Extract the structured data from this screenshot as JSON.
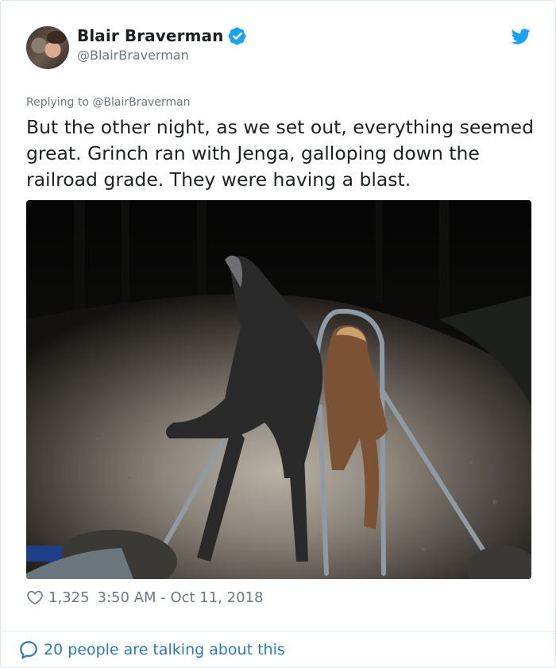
{
  "author": {
    "name": "Blair Braverman",
    "handle": "@BlairBraverman",
    "verified": true,
    "avatar_icon": "avatar-photo"
  },
  "tweet": {
    "replying_prefix": "Replying to ",
    "replying_to": "@BlairBraverman",
    "text": "But the other night, as we set out, everything seemed great. Grinch ran with Jenga, galloping down the railroad grade. They were having a blast.",
    "likes": "1,325",
    "timestamp": "3:50 AM - Oct 11, 2018"
  },
  "footer": {
    "talking": "20 people are talking about this"
  },
  "colors": {
    "twitter_blue": "#1da1f2",
    "link_blue": "#2b7bb9",
    "muted_gray": "#697882",
    "text": "#1c2022",
    "border": "#e1e8ed"
  },
  "icons": {
    "verified": "verified-badge-icon",
    "brand": "twitter-bird-icon",
    "like": "heart-icon",
    "conversation": "speech-bubble-icon"
  }
}
